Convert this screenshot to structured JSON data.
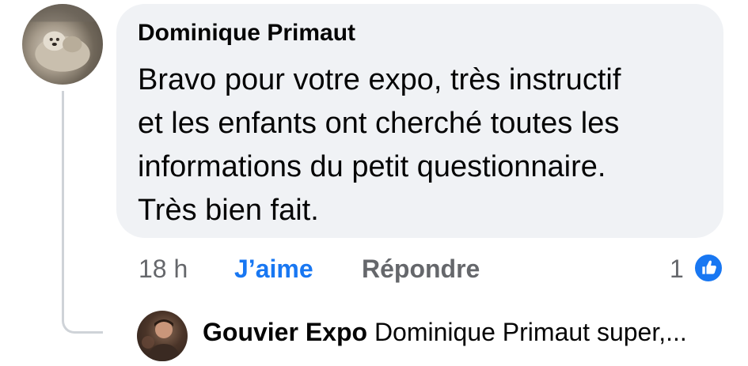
{
  "comment": {
    "author": "Dominique Primaut",
    "text_lines": [
      "Bravo pour votre expo, très instructif",
      "et les enfants ont cherché toutes les",
      "informations du petit questionnaire.",
      "Très bien fait."
    ],
    "time": "18 h",
    "like_label": "J’aime",
    "reply_label": "Répondre",
    "reaction_count": "1",
    "reaction_icon": "thumbs-up-icon"
  },
  "reply": {
    "author": "Gouvier Expo",
    "preview": "Dominique Primaut super,..."
  },
  "colors": {
    "bubble": "#f0f2f5",
    "link_blue": "#1877f2",
    "meta_gray": "#65676b",
    "text": "#050505"
  }
}
